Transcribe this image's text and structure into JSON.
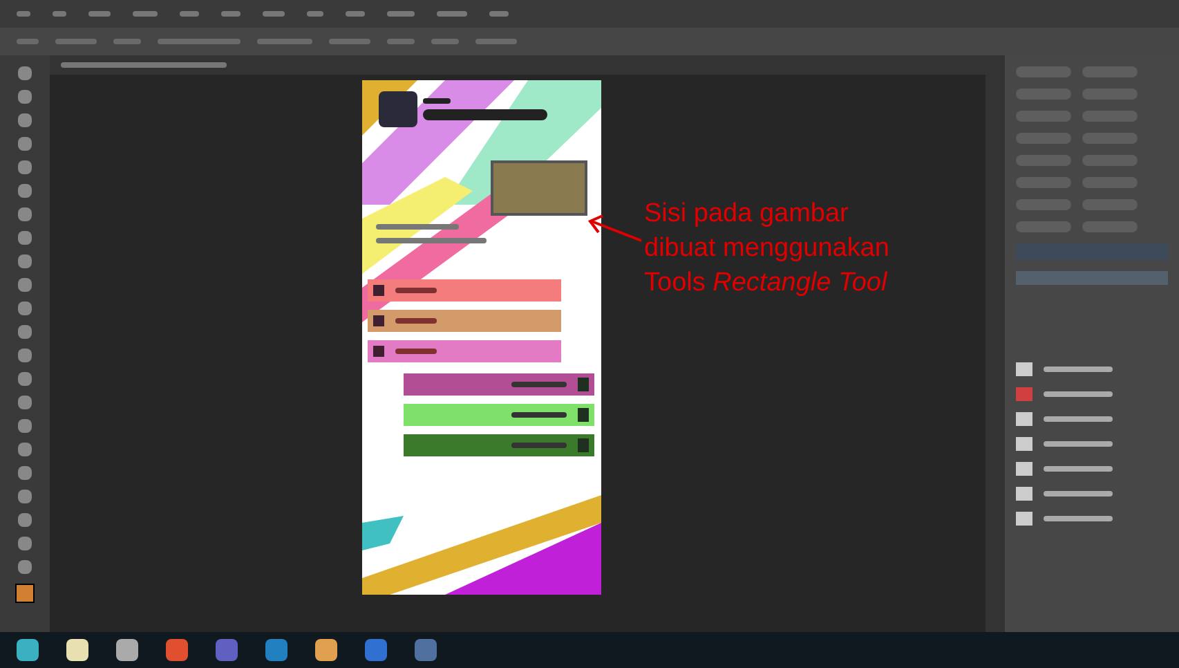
{
  "annotation": {
    "text": "Sisi pada gambar dibuat menggunakan Tools *Rectangle Tool*"
  },
  "design": {
    "menu_buttons": [
      {
        "color": "#f47c7c"
      },
      {
        "color": "#d39a6a"
      },
      {
        "color": "#e27bc4"
      }
    ],
    "action_buttons": [
      {
        "color": "#b24f94"
      },
      {
        "color": "#7fe06a"
      },
      {
        "color": "#3a7a2a"
      }
    ]
  }
}
